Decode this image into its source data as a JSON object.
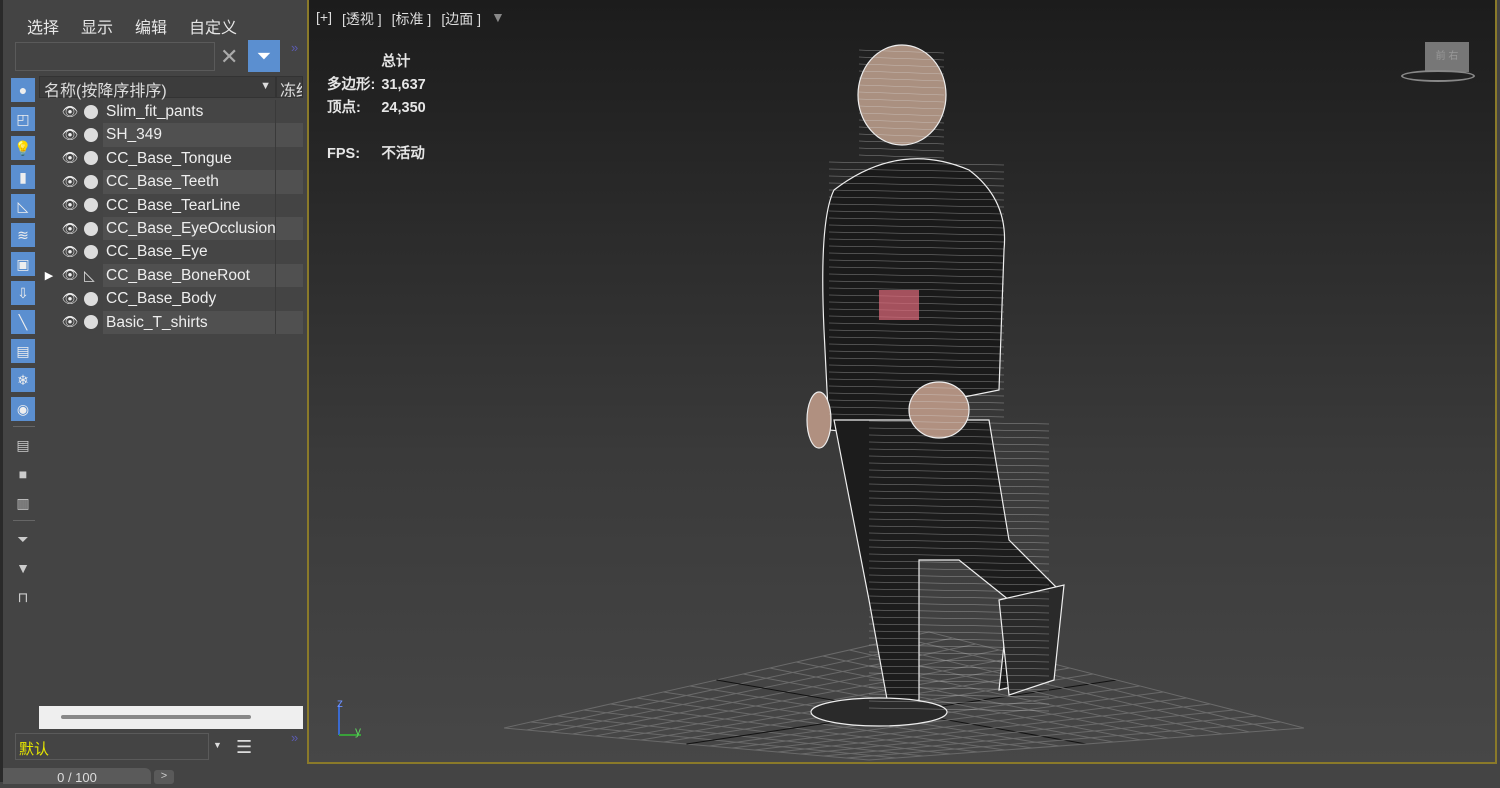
{
  "menu": [
    "选择",
    "显示",
    "编辑",
    "自定义"
  ],
  "search": {
    "value": "",
    "placeholder": ""
  },
  "columns": {
    "name": "名称(按降序排序)",
    "freeze": "冻结"
  },
  "objects": [
    {
      "name": "Slim_fit_pants",
      "type": "geometry"
    },
    {
      "name": "SH_349",
      "type": "geometry"
    },
    {
      "name": "CC_Base_Tongue",
      "type": "geometry"
    },
    {
      "name": "CC_Base_Teeth",
      "type": "geometry"
    },
    {
      "name": "CC_Base_TearLine",
      "type": "geometry"
    },
    {
      "name": "CC_Base_EyeOcclusion",
      "type": "geometry"
    },
    {
      "name": "CC_Base_Eye",
      "type": "geometry"
    },
    {
      "name": "CC_Base_BoneRoot",
      "type": "bone",
      "expandable": true
    },
    {
      "name": "CC_Base_Body",
      "type": "geometry"
    },
    {
      "name": "Basic_T_shirts",
      "type": "geometry"
    }
  ],
  "layer": {
    "value": "默认"
  },
  "timeline": {
    "label": "0 / 100"
  },
  "viewport": {
    "labels": [
      "[+]",
      "[透视 ]",
      "[标准 ]",
      "[边面 ]"
    ],
    "stats": {
      "header": "总计",
      "poly_label": "多边形:",
      "poly": "31,637",
      "vert_label": "顶点:",
      "vert": "24,350",
      "fps_label": "FPS:",
      "fps": "不活动"
    },
    "viewcube": "前 右",
    "axes": {
      "z": "z",
      "y": "y"
    }
  },
  "colors": {
    "accent": "#5b8fd0",
    "viewport_border": "#8a7a2a",
    "layer_text": "#e6e600"
  }
}
